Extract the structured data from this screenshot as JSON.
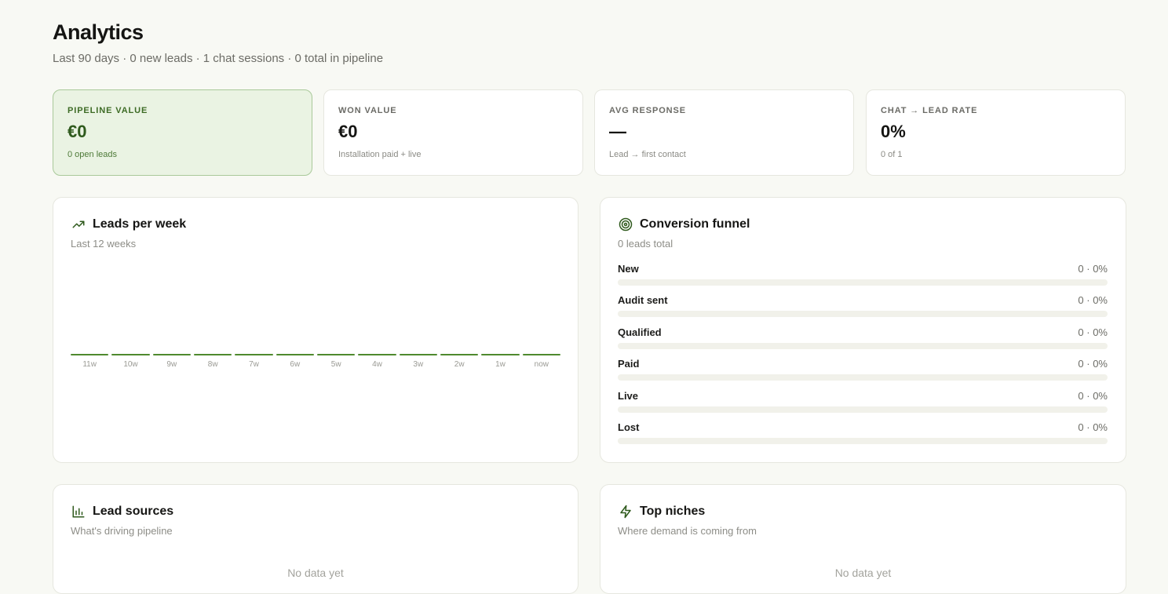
{
  "header": {
    "title": "Analytics",
    "subtitle": "Last 90 days · 0 new leads · 1 chat sessions · 0 total in pipeline"
  },
  "kpis": [
    {
      "label": "PIPELINE VALUE",
      "value": "€0",
      "note": "0 open leads",
      "active": true
    },
    {
      "label": "WON VALUE",
      "value": "€0",
      "note": "Installation paid + live",
      "active": false
    },
    {
      "label": "AVG RESPONSE",
      "value": "—",
      "note": "Lead → first contact",
      "active": false
    },
    {
      "label": "CHAT → LEAD RATE",
      "value": "0%",
      "note": "0 of 1",
      "active": false
    }
  ],
  "leads_per_week": {
    "title": "Leads per week",
    "subtitle": "Last 12 weeks",
    "icon": "trending-up-icon"
  },
  "chart_data": {
    "type": "bar",
    "categories": [
      "11w",
      "10w",
      "9w",
      "8w",
      "7w",
      "6w",
      "5w",
      "4w",
      "3w",
      "2w",
      "1w",
      "now"
    ],
    "values": [
      0,
      0,
      0,
      0,
      0,
      0,
      0,
      0,
      0,
      0,
      0,
      0
    ],
    "title": "Leads per week",
    "xlabel": "",
    "ylabel": "",
    "grid": false
  },
  "funnel": {
    "title": "Conversion funnel",
    "subtitle": "0 leads total",
    "icon": "target-icon",
    "stages": [
      {
        "label": "New",
        "value": "0 · 0%",
        "fraction": 0
      },
      {
        "label": "Audit sent",
        "value": "0 · 0%",
        "fraction": 0
      },
      {
        "label": "Qualified",
        "value": "0 · 0%",
        "fraction": 0
      },
      {
        "label": "Paid",
        "value": "0 · 0%",
        "fraction": 0
      },
      {
        "label": "Live",
        "value": "0 · 0%",
        "fraction": 0
      },
      {
        "label": "Lost",
        "value": "0 · 0%",
        "fraction": 0
      }
    ]
  },
  "lead_sources": {
    "title": "Lead sources",
    "subtitle": "What's driving pipeline",
    "empty": "No data yet",
    "icon": "bar-chart-icon"
  },
  "top_niches": {
    "title": "Top niches",
    "subtitle": "Where demand is coming from",
    "empty": "No data yet",
    "icon": "lightning-icon"
  },
  "colors": {
    "accent": "#4f8a2e",
    "accent_dark": "#2f5a1d",
    "background": "#f8f9f4"
  }
}
